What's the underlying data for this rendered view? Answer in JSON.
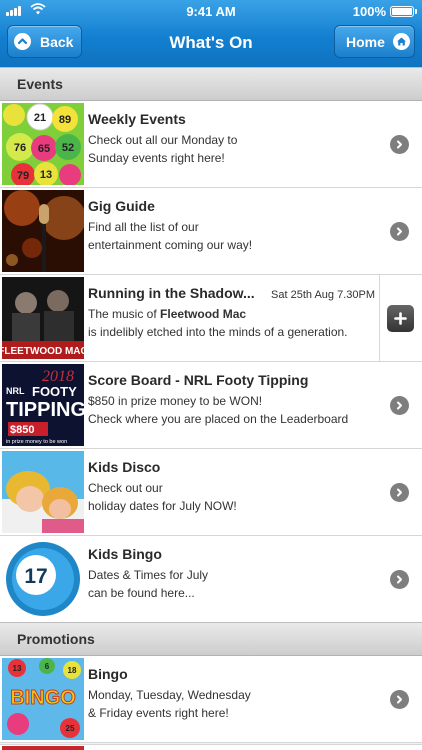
{
  "status_bar": {
    "time": "9:41 AM",
    "battery": "100%"
  },
  "nav": {
    "back_label": "Back",
    "title": "What's On",
    "home_label": "Home"
  },
  "sections": [
    {
      "title": "Events",
      "items": [
        {
          "title": "Weekly Events",
          "line1": "Check out all our Monday to",
          "line2": "Sunday events right here!",
          "thumb": "bingo-balls"
        },
        {
          "title": "Gig Guide",
          "line1": "Find all the list of our",
          "line2": "entertainment coming our way!",
          "thumb": "microphone"
        },
        {
          "title": "Running in the Shadow...",
          "date": "Sat 25th Aug 7.30PM",
          "line1_prefix": "The music of ",
          "line1_bold": "Fleetwood Mac",
          "line2": "is indelibly etched into the minds of a generation.",
          "thumb": "band-photo",
          "thumb_caption": "FLEETWOOD MAC"
        },
        {
          "title": "Score Board - NRL Footy Tipping",
          "line1": "$850 in prize money to be WON!",
          "line2": "Check where you are placed on the Leaderboard",
          "thumb": "footy-tipping",
          "thumb_text": {
            "year": "2018",
            "brand": "NRL",
            "footy": "FOOTY",
            "tipping": "TIPPING",
            "amount": "$850",
            "caption": "in prize money to be won"
          }
        },
        {
          "title": "Kids Disco",
          "line1": "Check out our",
          "line2": "holiday dates for July NOW!",
          "thumb": "kids-photo"
        },
        {
          "title": "Kids Bingo",
          "line1": "Dates & Times for July",
          "line2": "can be found here...",
          "thumb": "bingo-ball-17",
          "thumb_number": "17"
        }
      ]
    },
    {
      "title": "Promotions",
      "items": [
        {
          "title": "Bingo",
          "line1": "Monday, Tuesday, Wednesday",
          "line2": "& Friday events right here!",
          "thumb": "bingo-promo",
          "thumb_text": "BINGO"
        }
      ]
    }
  ],
  "thumb_balls": [
    "21",
    "89",
    "76",
    "65",
    "52",
    "79",
    "13"
  ],
  "promo_balls": [
    "13",
    "6",
    "18",
    "25"
  ],
  "colors": {
    "header": "#137fd0",
    "section_header": "#d6d6d6",
    "chevron": "#7e7e7e",
    "add_button": "#444444"
  }
}
